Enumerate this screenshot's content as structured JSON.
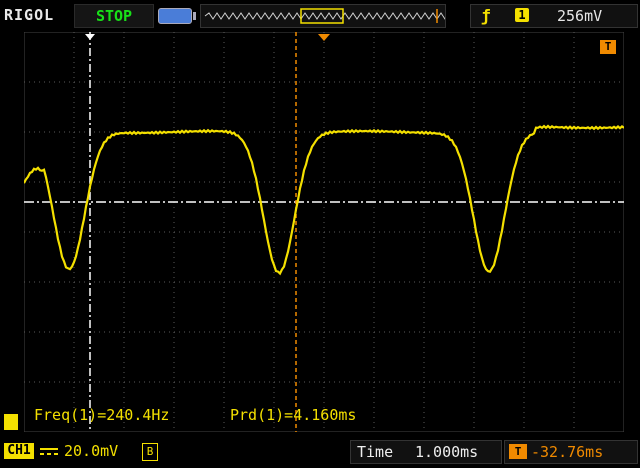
{
  "brand": "RIGOL",
  "status": "STOP",
  "trigger": {
    "edge_icon": "rising-edge-icon",
    "channel": "1",
    "level": "256mV"
  },
  "measurements": {
    "frequency": "Freq(1)=240.4Hz",
    "period": "Prd(1)=4.160ms"
  },
  "channel": {
    "tag": "CH1",
    "scale": "20.0mV",
    "bandwidth_limit": "B"
  },
  "timebase": {
    "label": "Time",
    "value": "1.000ms"
  },
  "trigger_offset": {
    "icon": "T",
    "value": "-32.76ms"
  },
  "trigger_marker": {
    "label": "T"
  },
  "colors": {
    "trace": "#f4e000",
    "accent": "#f08a00",
    "status": "#18e018"
  }
}
